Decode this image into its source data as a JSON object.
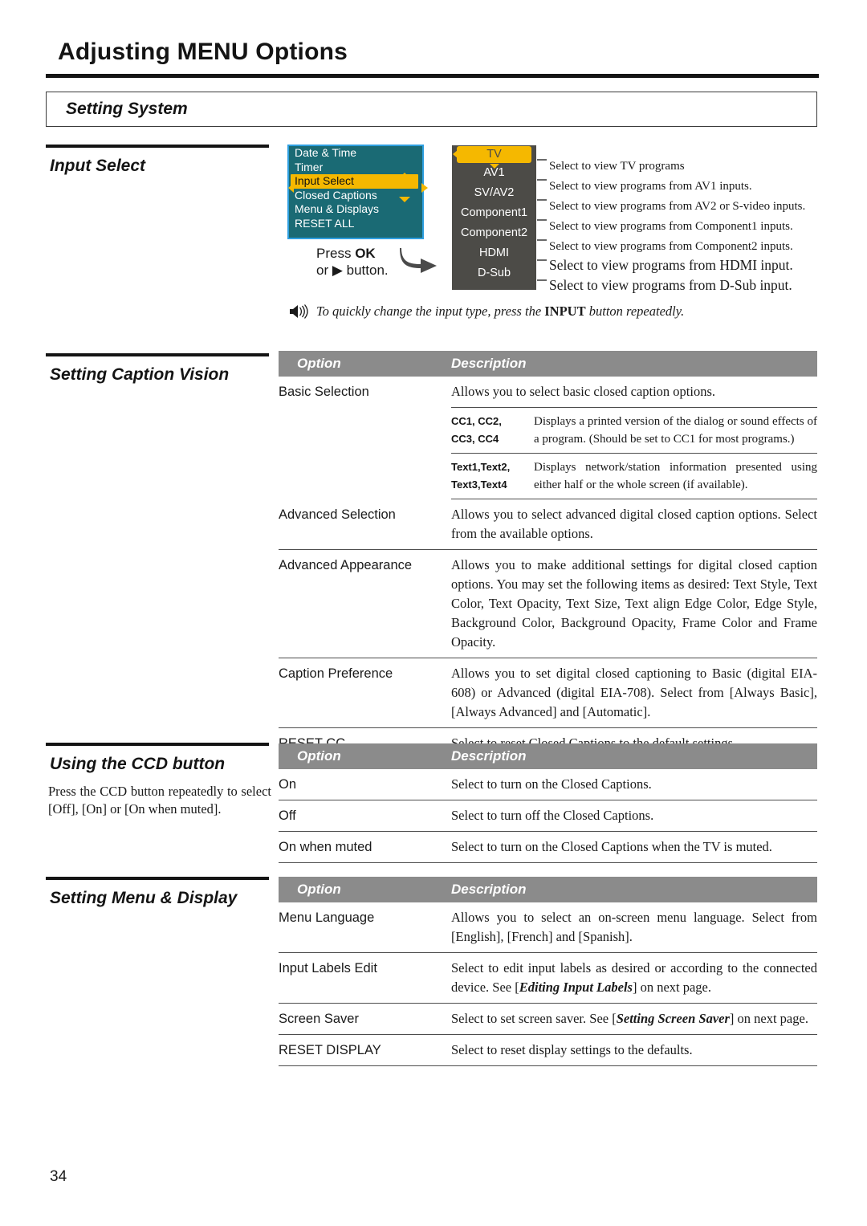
{
  "header": {
    "title": "Adjusting MENU Options",
    "section_band": "Setting System"
  },
  "left_headings": {
    "input_select": "Input Select",
    "caption_vision": "Setting Caption Vision",
    "ccd_button": "Using the CCD button",
    "menu_display": "Setting Menu & Display"
  },
  "ccd_body": "Press the CCD button repeatedly to select [Off], [On] or [On when muted].",
  "osd_menu": {
    "items": [
      {
        "label": "Date & Time",
        "selected": false
      },
      {
        "label": "Timer",
        "selected": false
      },
      {
        "label": "Input Select",
        "selected": true
      },
      {
        "label": "Closed Captions",
        "selected": false
      },
      {
        "label": "Menu & Displays",
        "selected": false
      },
      {
        "label": "RESET ALL",
        "selected": false
      }
    ],
    "press_line1_a": "Press ",
    "press_line1_b": "OK",
    "press_line2_a": "or ",
    "press_line2_b": "▶",
    "press_line2_c": " button.",
    "colors": {
      "panel_bg": "#1a6a74",
      "panel_border": "#2e9fe0",
      "highlight": "#f5b800"
    }
  },
  "input_list": {
    "items": [
      {
        "label": "TV",
        "selected": true,
        "description": "Select to view TV programs",
        "emphasis": false
      },
      {
        "label": "AV1",
        "selected": false,
        "description": "Select to view programs from AV1 inputs.",
        "emphasis": false
      },
      {
        "label": "SV/AV2",
        "selected": false,
        "description": "Select to view programs from AV2 or S-video inputs.",
        "emphasis": false
      },
      {
        "label": "Component1",
        "selected": false,
        "description": "Select to view programs from Component1 inputs.",
        "emphasis": false
      },
      {
        "label": "Component2",
        "selected": false,
        "description": "Select to view programs from Component2 inputs.",
        "emphasis": false
      },
      {
        "label": "HDMI",
        "selected": false,
        "description": "Select to view programs from HDMI input.",
        "emphasis": true
      },
      {
        "label": "D-Sub",
        "selected": false,
        "description": "Select to view programs from D-Sub input.",
        "emphasis": true
      }
    ],
    "colors": {
      "panel_bg": "#4c4b47",
      "highlight": "#f5b800"
    }
  },
  "note": {
    "icon": "speaker-icon",
    "text_before": "To quickly change the input type, press the ",
    "text_bold": "INPUT",
    "text_after": " button repeatedly."
  },
  "tables": {
    "headers": {
      "option": "Option",
      "description": "Description"
    },
    "caption_vision": [
      {
        "option": "Basic Selection",
        "description": "Allows you to select basic closed caption options.",
        "subrows": [
          {
            "label_line1": "CC1, CC2,",
            "label_line2": "CC3, CC4",
            "text": "Displays a printed version of the dialog or sound effects of a program. (Should be set to CC1 for most programs.)"
          },
          {
            "label_line1": "Text1,Text2,",
            "label_line2": "Text3,Text4",
            "text": "Displays network/station information presented using either half or the whole screen (if available)."
          }
        ]
      },
      {
        "option": "Advanced Selection",
        "description": "Allows you to select advanced digital closed caption options. Select from the available options.",
        "subrows": []
      },
      {
        "option": "Advanced Appearance",
        "description": "Allows you to make additional settings for digital closed caption options. You may set the following items as desired: Text Style, Text Color, Text Opacity, Text Size, Text align Edge Color, Edge Style, Background Color, Background Opacity, Frame Color and Frame Opacity.",
        "subrows": []
      },
      {
        "option": "Caption Preference",
        "description": "Allows you to set digital closed captioning to Basic (digital EIA-608) or Advanced (digital EIA-708). Select from [Always Basic], [Always Advanced] and [Automatic].",
        "subrows": []
      },
      {
        "option": "RESET CC",
        "description": "Select to reset Closed Captions to the default settings.",
        "subrows": []
      }
    ],
    "ccd": [
      {
        "option": "On",
        "description": "Select to turn on the Closed Captions."
      },
      {
        "option": "Off",
        "description": "Select to turn off the Closed Captions."
      },
      {
        "option": "On when muted",
        "description": "Select to turn on the Closed Captions when the TV is muted."
      }
    ],
    "menu_display": [
      {
        "option": "Menu Language",
        "desc_parts": [
          {
            "text": "Allows you to select an on-screen menu language. Select from [English], [French] and [Spanish].",
            "style": "normal"
          }
        ]
      },
      {
        "option": "Input Labels Edit",
        "desc_parts": [
          {
            "text": "Select to edit input labels as desired or according to the connected device. See [",
            "style": "normal"
          },
          {
            "text": "Editing Input Labels",
            "style": "bold-italic"
          },
          {
            "text": "] on next page.",
            "style": "normal"
          }
        ]
      },
      {
        "option": "Screen Saver",
        "desc_parts": [
          {
            "text": "Select to set screen saver. See [",
            "style": "normal"
          },
          {
            "text": "Setting Screen Saver",
            "style": "bold-italic"
          },
          {
            "text": "] on next page.",
            "style": "normal"
          }
        ]
      },
      {
        "option": "RESET DISPLAY",
        "desc_parts": [
          {
            "text": "Select to reset display settings to the defaults.",
            "style": "normal"
          }
        ]
      }
    ]
  },
  "page_number": "34"
}
